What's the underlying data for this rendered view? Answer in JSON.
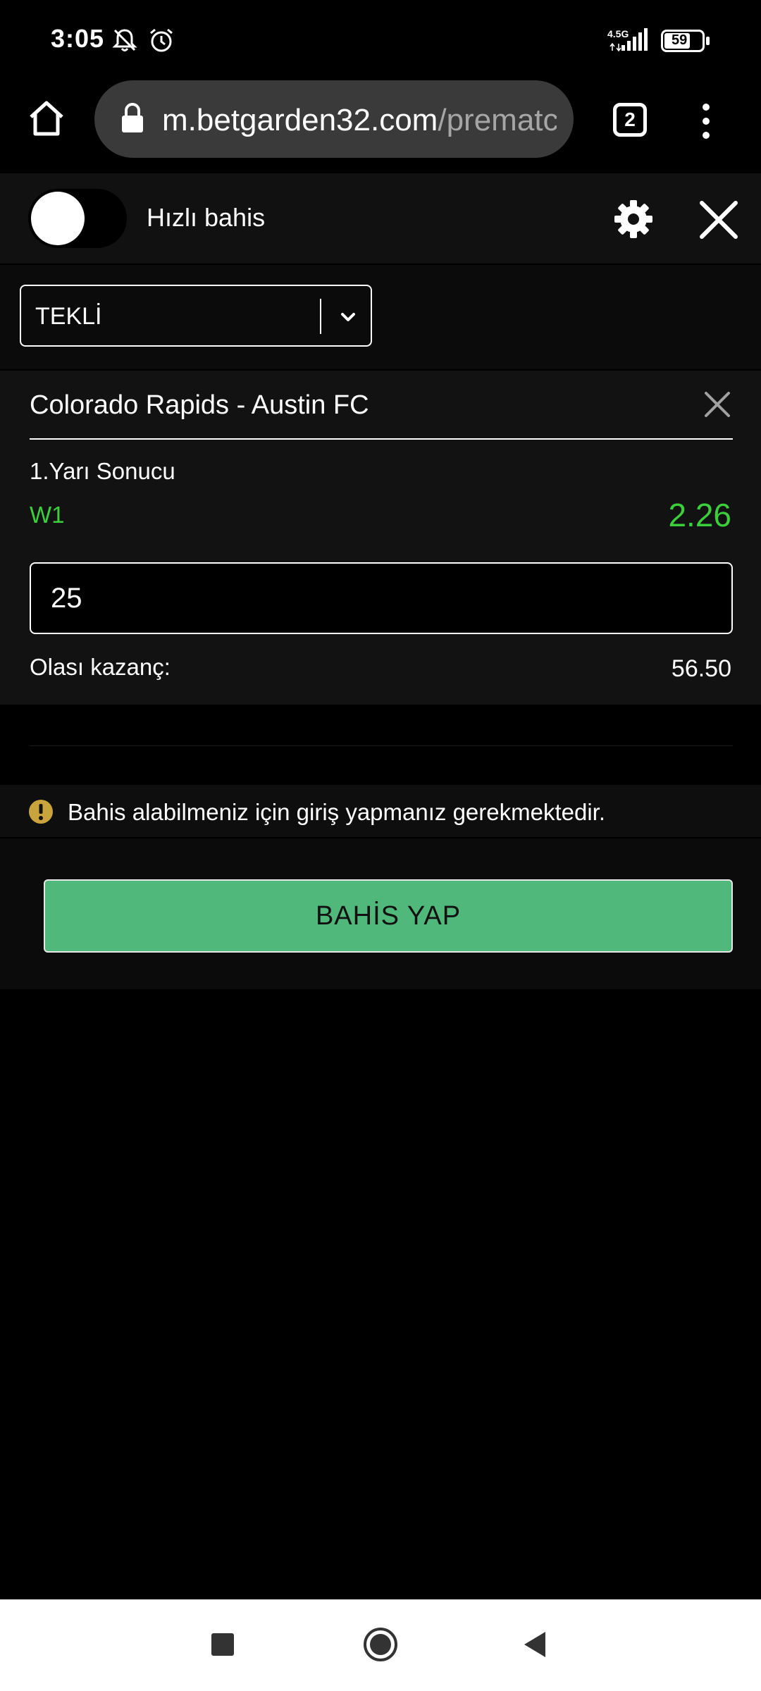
{
  "status_bar": {
    "time": "3:05",
    "network": "4.5G",
    "battery": "59",
    "icons": [
      "mute-icon",
      "alarm-icon",
      "signal-icon",
      "battery-icon"
    ]
  },
  "browser": {
    "url_host": "m.betgarden32.com",
    "url_path": "/prematch",
    "tab_count": "2",
    "icons": [
      "home-icon",
      "lock-icon",
      "more-vertical-icon"
    ]
  },
  "quick_bet": {
    "label": "Hızlı bahis",
    "enabled": false
  },
  "bet_type": {
    "selected": "TEKLİ"
  },
  "bet": {
    "match": "Colorado Rapids - Austin FC",
    "market": "1.Yarı Sonucu",
    "selection": "W1",
    "odds": "2.26",
    "stake": "25",
    "potential_win_label": "Olası kazanç:",
    "potential_win": "56.50"
  },
  "notice": {
    "text": "Bahis alabilmeniz için giriş yapmanız gerekmektedir."
  },
  "actions": {
    "place_bet_label": "BAHİS YAP"
  },
  "colors": {
    "accent_green": "#3bd03b",
    "button_green": "#51b87b",
    "warning": "#c9a43c"
  }
}
